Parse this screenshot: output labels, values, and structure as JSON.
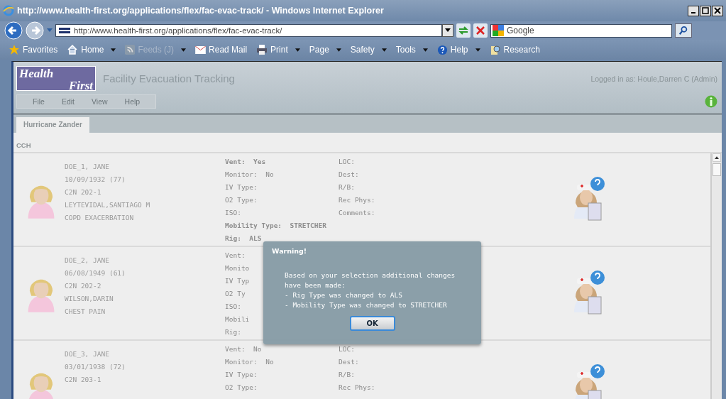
{
  "window": {
    "title": "http://www.health-first.org/applications/flex/fac-evac-track/ - Windows Internet Explorer"
  },
  "address_bar": {
    "url": "http://www.health-first.org/applications/flex/fac-evac-track/"
  },
  "search": {
    "placeholder": "Google"
  },
  "toolbar": [
    {
      "label": "Favorites",
      "dropdown": false,
      "disabled": false
    },
    {
      "label": "Home",
      "dropdown": true,
      "disabled": false
    },
    {
      "label": "Feeds (J)",
      "dropdown": true,
      "disabled": true
    },
    {
      "label": "Read Mail",
      "dropdown": false,
      "disabled": false
    },
    {
      "label": "Print",
      "dropdown": true,
      "disabled": false
    },
    {
      "label": "Page",
      "dropdown": true,
      "disabled": false
    },
    {
      "label": "Safety",
      "dropdown": true,
      "disabled": false
    },
    {
      "label": "Tools",
      "dropdown": true,
      "disabled": false
    },
    {
      "label": "Help",
      "dropdown": true,
      "disabled": false
    },
    {
      "label": "Research",
      "dropdown": false,
      "disabled": false
    }
  ],
  "app": {
    "logo": {
      "line_1": "Health",
      "line_2": "First"
    },
    "title": "Facility Evacuation Tracking",
    "logged_in": "Logged in as: Houle,Darren C (Admin)",
    "menu": [
      "File",
      "Edit",
      "View",
      "Help"
    ]
  },
  "tabs": [
    {
      "label": "Hurricane Zander",
      "selected": true
    }
  ],
  "section": {
    "title": "CCH"
  },
  "patients": [
    {
      "info": [
        "DOE_1, JANE",
        "10/09/1932 (77)",
        "C2N 202-1",
        "LEYTEVIDAL,SANTIAGO M",
        "COPD EXACERBATION"
      ],
      "fields_left": [
        {
          "label": "Vent:",
          "value": "Yes",
          "bold": true
        },
        {
          "label": "Monitor:",
          "value": "No",
          "bold": false
        },
        {
          "label": "IV Type:",
          "bold": false
        },
        {
          "label": "O2 Type:",
          "bold": false
        },
        {
          "label": "ISO:",
          "bold": false
        },
        {
          "label": "Mobility Type:",
          "value": "STRETCHER",
          "bold": true
        },
        {
          "label": "Rig:",
          "value": "ALS",
          "bold": true
        }
      ],
      "fields_right": [
        {
          "label": "LOC:",
          "bold": false
        },
        {
          "label": "Dest:",
          "bold": false
        },
        {
          "label": "R/B:",
          "bold": false
        },
        {
          "label": "Rec Phys:",
          "bold": false
        },
        {
          "label": "Comments:",
          "bold": false
        }
      ]
    },
    {
      "info": [
        "DOE_2, JANE",
        "06/08/1949 (61)",
        "C2N 202-2",
        "WILSON,DARIN",
        "CHEST PAIN"
      ],
      "fields_left": [
        {
          "label": "Vent:",
          "bold": false
        },
        {
          "label": "Monito",
          "bold": false
        },
        {
          "label": "IV Typ",
          "bold": false
        },
        {
          "label": "O2 Ty",
          "bold": false
        },
        {
          "label": "ISO:",
          "bold": false
        },
        {
          "label": "Mobili",
          "bold": false
        },
        {
          "label": "Rig:",
          "bold": false
        }
      ]
    },
    {
      "info": [
        "DOE_3, JANE",
        "03/01/1938 (72)",
        "C2N 203-1"
      ],
      "fields_left": [
        {
          "label": "Vent:",
          "value": "No",
          "bold": false
        },
        {
          "label": "Monitor:",
          "value": "No",
          "bold": false
        },
        {
          "label": "IV Type:",
          "bold": false
        },
        {
          "label": "O2 Type:",
          "bold": false
        }
      ],
      "fields_right": [
        {
          "label": "LOC:",
          "bold": false
        },
        {
          "label": "Dest:",
          "bold": false
        },
        {
          "label": "R/B:",
          "bold": false
        },
        {
          "label": "Rec Phys:",
          "bold": false
        }
      ]
    }
  ],
  "dialog": {
    "title": "Warning!",
    "message": [
      "Based on your selection additional changes",
      "have been made:",
      "- Rig Type was changed to ALS",
      "- Mobility Type was changed to STRETCHER"
    ],
    "button": "OK"
  }
}
